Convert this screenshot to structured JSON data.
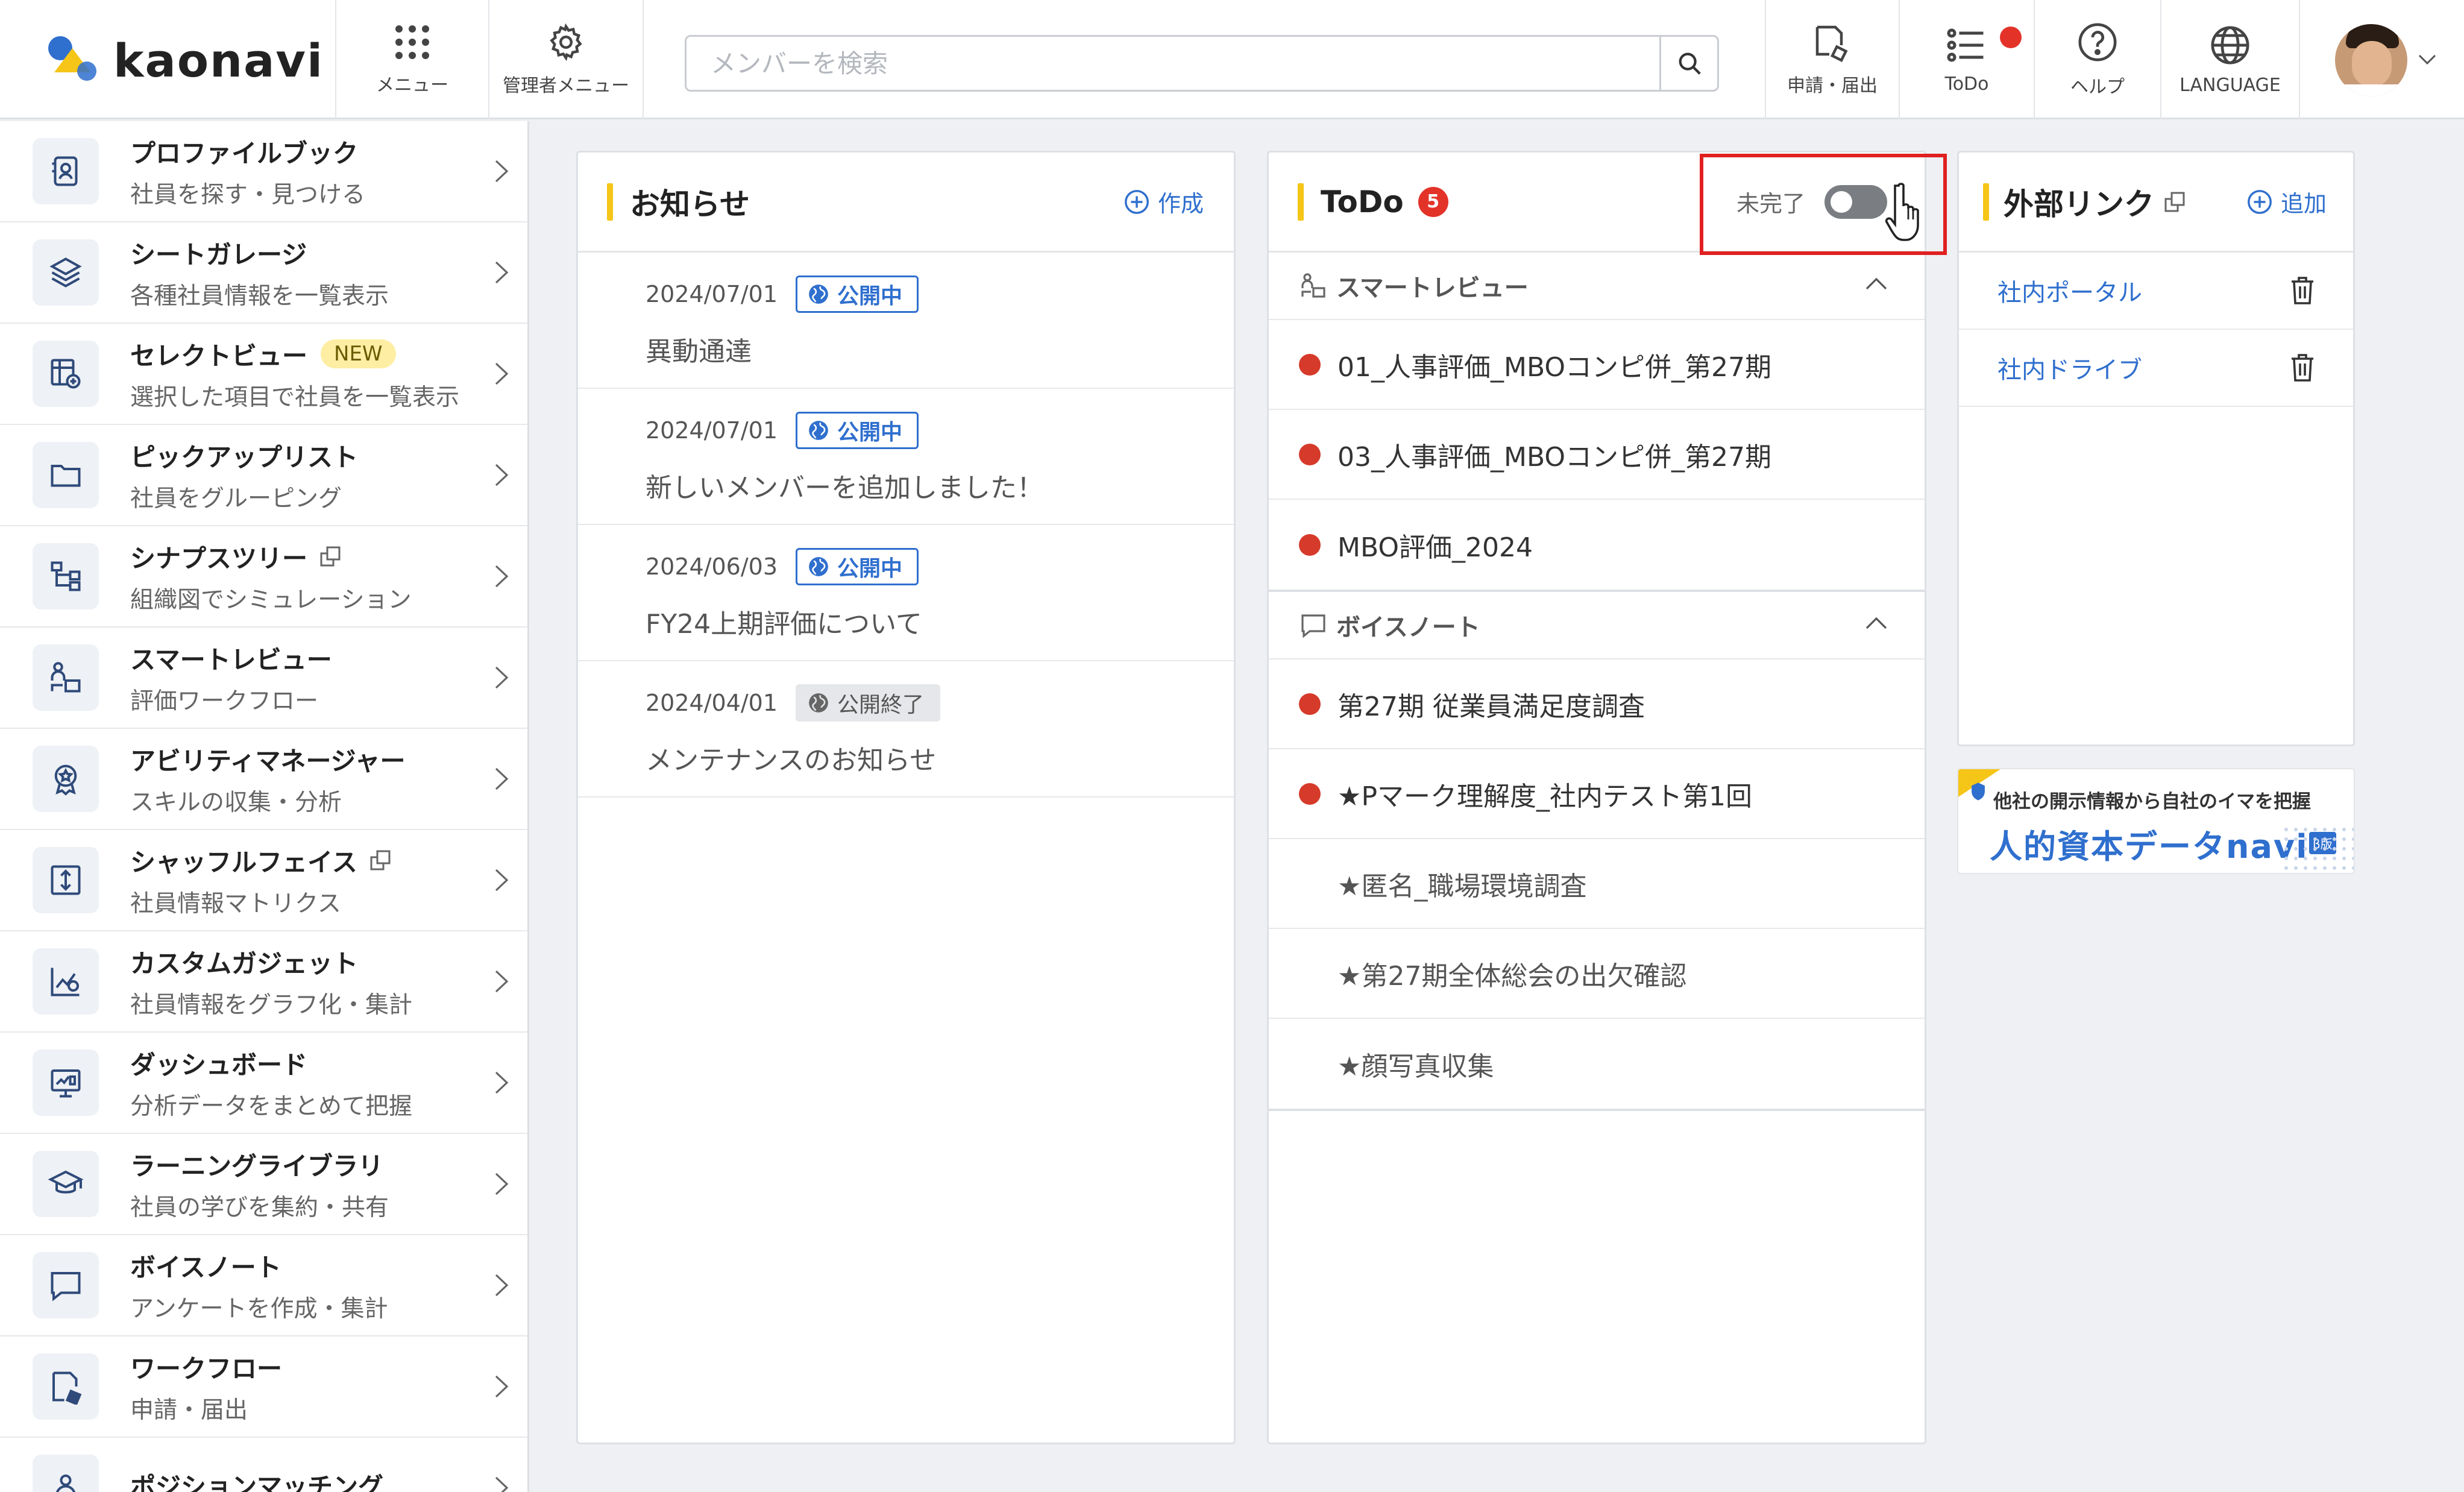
{
  "header": {
    "logo_text": "kaonavi",
    "menu_label": "メニュー",
    "admin_menu_label": "管理者メニュー",
    "search_placeholder": "メンバーを検索",
    "application_label": "申請・届出",
    "todo_label": "ToDo",
    "help_label": "ヘルプ",
    "language_label": "LANGUAGE"
  },
  "sidebar": {
    "items": [
      {
        "title": "プロファイルブック",
        "subtitle": "社員を探す・見つける",
        "icon": "profile-book-icon"
      },
      {
        "title": "シートガレージ",
        "subtitle": "各種社員情報を一覧表示",
        "icon": "layers-icon"
      },
      {
        "title": "セレクトビュー",
        "subtitle": "選択した項目で社員を一覧表示",
        "icon": "select-view-icon",
        "badge": "NEW"
      },
      {
        "title": "ピックアップリスト",
        "subtitle": "社員をグルーピング",
        "icon": "folder-icon"
      },
      {
        "title": "シナプスツリー",
        "subtitle": "組織図でシミュレーション",
        "icon": "org-tree-icon",
        "external": true
      },
      {
        "title": "スマートレビュー",
        "subtitle": "評価ワークフロー",
        "icon": "smart-review-icon"
      },
      {
        "title": "アビリティマネージャー",
        "subtitle": "スキルの収集・分析",
        "icon": "award-icon"
      },
      {
        "title": "シャッフルフェイス",
        "subtitle": "社員情報マトリクス",
        "icon": "shuffle-icon",
        "external": true
      },
      {
        "title": "カスタムガジェット",
        "subtitle": "社員情報をグラフ化・集計",
        "icon": "chart-icon"
      },
      {
        "title": "ダッシュボード",
        "subtitle": "分析データをまとめて把握",
        "icon": "dashboard-icon"
      },
      {
        "title": "ラーニングライブラリ",
        "subtitle": "社員の学びを集約・共有",
        "icon": "graduation-cap-icon"
      },
      {
        "title": "ボイスノート",
        "subtitle": "アンケートを作成・集計",
        "icon": "speech-bubble-icon"
      },
      {
        "title": "ワークフロー",
        "subtitle": "申請・届出",
        "icon": "workflow-icon"
      },
      {
        "title": "ポジションマッチング",
        "subtitle": "",
        "icon": "position-icon"
      }
    ]
  },
  "news": {
    "title": "お知らせ",
    "create_label": "作成",
    "items": [
      {
        "date": "2024/07/01",
        "status": "公開中",
        "title": "異動通達"
      },
      {
        "date": "2024/07/01",
        "status": "公開中",
        "title": "新しいメンバーを追加しました！"
      },
      {
        "date": "2024/06/03",
        "status": "公開中",
        "title": "FY24上期評価について"
      },
      {
        "date": "2024/04/01",
        "status": "公開終了",
        "title": "メンテナンスのお知らせ"
      }
    ]
  },
  "todo": {
    "title": "ToDo",
    "count": "5",
    "toggle_label": "未完了",
    "sections": [
      {
        "title": "スマートレビュー",
        "items": [
          {
            "text": "01_人事評価_MBOコンピ併_第27期",
            "pending": true
          },
          {
            "text": "03_人事評価_MBOコンピ併_第27期",
            "pending": true
          },
          {
            "text": "MBO評価_2024",
            "pending": true
          }
        ]
      },
      {
        "title": "ボイスノート",
        "items": [
          {
            "text": "第27期 従業員満足度調査",
            "pending": true
          },
          {
            "text": "★Pマーク理解度_社内テスト第1回",
            "pending": true
          },
          {
            "text": "★匿名_職場環境調査",
            "pending": false
          },
          {
            "text": "★第27期全体総会の出欠確認",
            "pending": false
          },
          {
            "text": "★顔写真収集",
            "pending": false
          }
        ]
      }
    ]
  },
  "links": {
    "title": "外部リンク",
    "add_label": "追加",
    "items": [
      {
        "text": "社内ポータル"
      },
      {
        "text": "社内ドライブ"
      }
    ]
  },
  "banner": {
    "line1": "他社の開示情報から自社のイマを把握",
    "line2": "人的資本データnavi",
    "tag": "β版"
  },
  "colors": {
    "accent": "#2f6fce",
    "notice_red": "#e33329",
    "section_bar": "#f5c518"
  }
}
